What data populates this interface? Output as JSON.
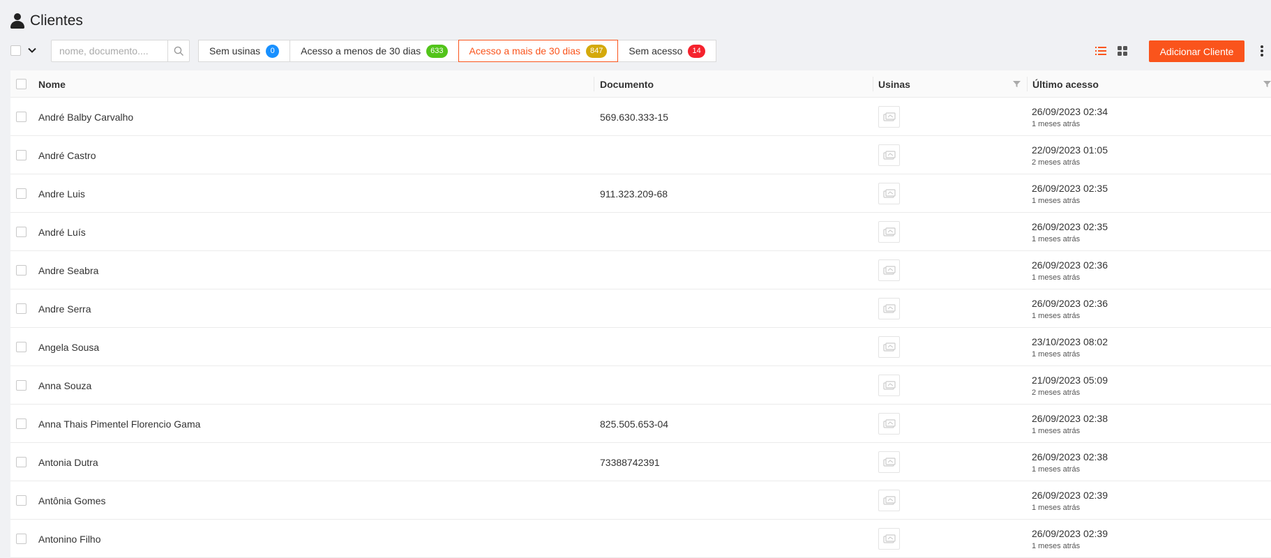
{
  "page": {
    "title": "Clientes",
    "icon": "user-icon"
  },
  "search": {
    "placeholder": "nome, documento...."
  },
  "filters": [
    {
      "label": "Sem usinas",
      "count": "0",
      "color": "#1890ff",
      "active": false
    },
    {
      "label": "Acesso a menos de 30 dias",
      "count": "633",
      "color": "#52c41a",
      "active": false
    },
    {
      "label": "Acesso a mais de 30 dias",
      "count": "847",
      "color": "#d4a90b",
      "active": true
    },
    {
      "label": "Sem acesso",
      "count": "14",
      "color": "#f5222d",
      "active": false
    }
  ],
  "toolbar": {
    "add_label": "Adicionar Cliente",
    "accent": "#fa541c"
  },
  "table": {
    "columns": {
      "name": "Nome",
      "document": "Documento",
      "usinas": "Usinas",
      "last_access": "Último acesso"
    },
    "rows": [
      {
        "name": "André Balby Carvalho",
        "document": "569.630.333-15",
        "date": "26/09/2023 02:34",
        "ago": "1 meses atrás"
      },
      {
        "name": "André Castro",
        "document": "",
        "date": "22/09/2023 01:05",
        "ago": "2 meses atrás"
      },
      {
        "name": "Andre Luis",
        "document": "911.323.209-68",
        "date": "26/09/2023 02:35",
        "ago": "1 meses atrás"
      },
      {
        "name": "André Luís",
        "document": "",
        "date": "26/09/2023 02:35",
        "ago": "1 meses atrás"
      },
      {
        "name": "Andre Seabra",
        "document": "",
        "date": "26/09/2023 02:36",
        "ago": "1 meses atrás"
      },
      {
        "name": "Andre Serra",
        "document": "",
        "date": "26/09/2023 02:36",
        "ago": "1 meses atrás"
      },
      {
        "name": "Angela Sousa",
        "document": "",
        "date": "23/10/2023 08:02",
        "ago": "1 meses atrás"
      },
      {
        "name": "Anna Souza",
        "document": "",
        "date": "21/09/2023 05:09",
        "ago": "2 meses atrás"
      },
      {
        "name": "Anna Thais Pimentel Florencio Gama",
        "document": "825.505.653-04",
        "date": "26/09/2023 02:38",
        "ago": "1 meses atrás"
      },
      {
        "name": "Antonia Dutra",
        "document": "73388742391",
        "date": "26/09/2023 02:38",
        "ago": "1 meses atrás"
      },
      {
        "name": "Antônia Gomes",
        "document": "",
        "date": "26/09/2023 02:39",
        "ago": "1 meses atrás"
      },
      {
        "name": "Antonino Filho",
        "document": "",
        "date": "26/09/2023 02:39",
        "ago": "1 meses atrás"
      }
    ]
  }
}
